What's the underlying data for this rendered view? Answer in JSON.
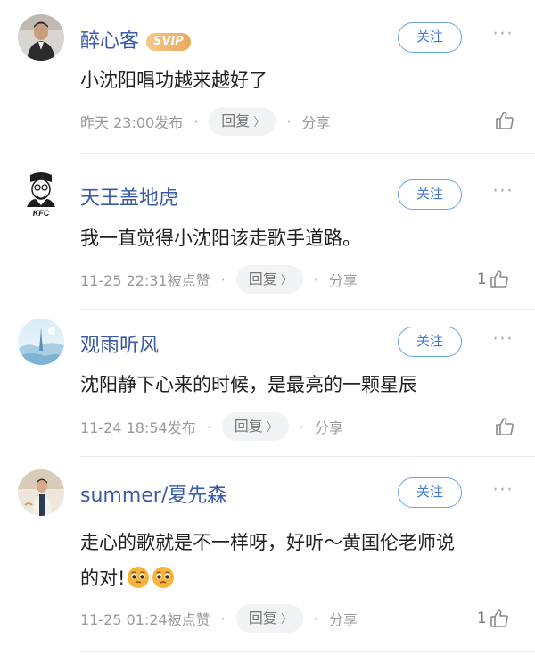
{
  "comments": [
    {
      "username": "醉心客",
      "badge": "SVIP",
      "follow_label": "关注",
      "more_label": "···",
      "text": "小沈阳唱功越来越好了",
      "time": "昨天 23:00发布",
      "reply_label": "回复",
      "reply_chevron": "〉",
      "share_label": "分享",
      "separator": "·",
      "likes": ""
    },
    {
      "username": "天王盖地虎",
      "follow_label": "关注",
      "more_label": "···",
      "text": "我一直觉得小沈阳该走歌手道路。",
      "time": "11-25 22:31被点赞",
      "reply_label": "回复",
      "reply_chevron": "〉",
      "share_label": "分享",
      "separator": "·",
      "likes": "1"
    },
    {
      "username": "观雨听风",
      "follow_label": "关注",
      "more_label": "···",
      "text": "沈阳静下心来的时候，是最亮的一颗星辰",
      "time": "11-24 18:54发布",
      "reply_label": "回复",
      "reply_chevron": "〉",
      "share_label": "分享",
      "separator": "·",
      "likes": ""
    },
    {
      "username": "summer/夏先森",
      "follow_label": "关注",
      "more_label": "···",
      "text_line1": "走心的歌就是不一样呀，好听～黄国伦老师说",
      "text_line2": "的对!",
      "time": "11-25 01:24被点赞",
      "reply_label": "回复",
      "reply_chevron": "〉",
      "share_label": "分享",
      "separator": "·",
      "likes": "1"
    }
  ],
  "avatar_icons": [
    "user-avatar-icon",
    "kfc-avatar-icon",
    "landscape-avatar-icon",
    "person-avatar-icon"
  ],
  "colors": {
    "username": "#3a5aa8",
    "follow_border": "#6aa0e8",
    "follow_text": "#3f7ad9",
    "meta_text": "#9a9a9a",
    "reply_bg": "#f2f3f5"
  }
}
